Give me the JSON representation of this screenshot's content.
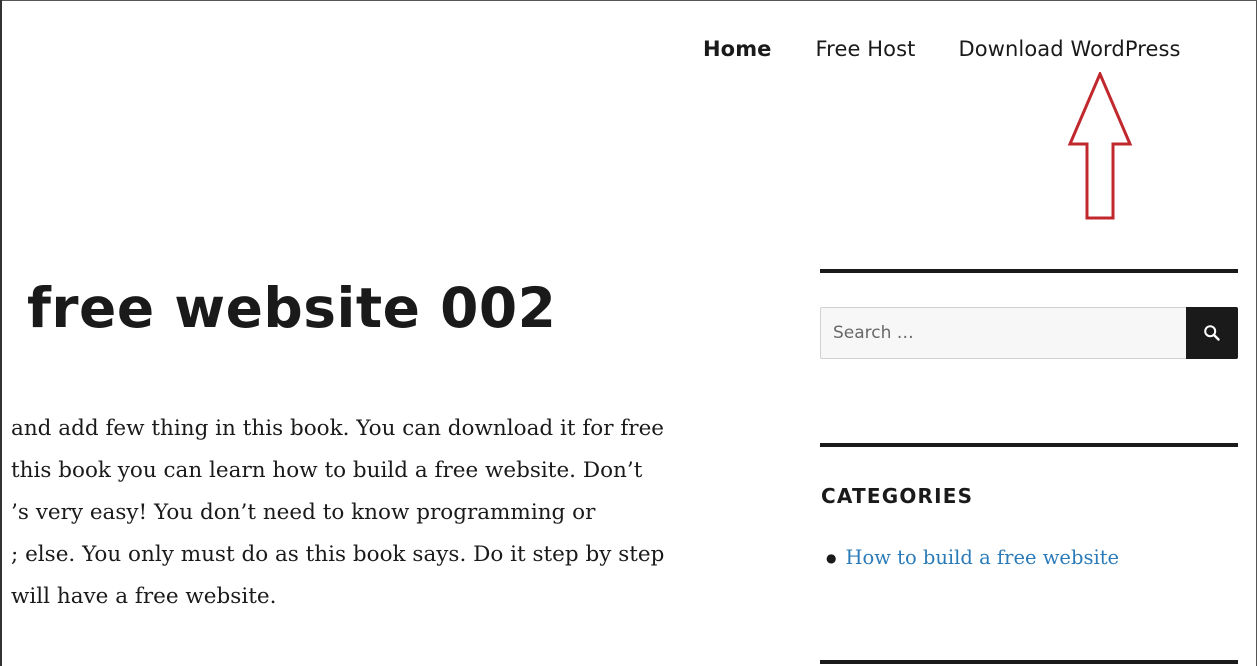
{
  "nav": {
    "items": [
      {
        "label": "Home"
      },
      {
        "label": "Free Host"
      },
      {
        "label": "Download WordPress"
      }
    ]
  },
  "post": {
    "title": "free website 002",
    "lines": [
      "and add few thing in this book. You can download it for free",
      "this book you can learn how to build a free website. Don’t",
      "’s very easy! You don’t need to know programming or",
      "; else. You only must do as this book says. Do it step by step",
      "will have a free website."
    ]
  },
  "sidebar": {
    "search": {
      "placeholder": "Search …",
      "button_icon": "search-icon"
    },
    "categories": {
      "title": "CATEGORIES",
      "items": [
        {
          "label": "How to build a free website"
        }
      ]
    }
  },
  "colors": {
    "text": "#1a1a1a",
    "link": "#2b7bb9",
    "annotation_arrow": "#c0282d",
    "search_button_bg": "#1a1a1a"
  },
  "annotation": {
    "arrow_icon": "up-arrow-icon"
  }
}
